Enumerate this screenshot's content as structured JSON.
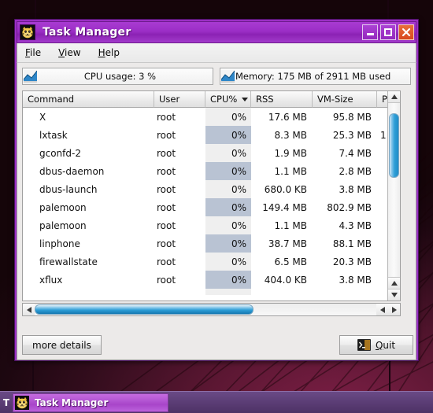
{
  "window": {
    "title": "Task Manager",
    "icon": "cat-icon",
    "controls": {
      "minimize": "minimize-button",
      "maximize": "maximize-button",
      "close": "close-button"
    }
  },
  "menubar": {
    "items": [
      {
        "label": "File",
        "mnemonic": "F"
      },
      {
        "label": "View",
        "mnemonic": "V"
      },
      {
        "label": "Help",
        "mnemonic": "H"
      }
    ]
  },
  "gauges": {
    "cpu": {
      "label": "CPU usage: 3 %",
      "icon": "cpu-chart-icon",
      "percent": 3
    },
    "memory": {
      "label": "Memory: 175 MB of 2911 MB used",
      "icon": "memory-chart-icon",
      "used_mb": 175,
      "total_mb": 2911
    }
  },
  "table": {
    "columns": [
      {
        "key": "command",
        "label": "Command",
        "sorted": false
      },
      {
        "key": "user",
        "label": "User",
        "sorted": false
      },
      {
        "key": "cpu",
        "label": "CPU%",
        "sorted": true,
        "sort_direction": "descending"
      },
      {
        "key": "rss",
        "label": "RSS",
        "sorted": false
      },
      {
        "key": "vm",
        "label": "VM-Size",
        "sorted": false
      },
      {
        "key": "p",
        "label": "P",
        "sorted": false
      }
    ],
    "rows": [
      {
        "command": "X",
        "user": "root",
        "cpu": "0%",
        "rss": "17.6 MB",
        "vm": "95.8 MB",
        "p": ""
      },
      {
        "command": "lxtask",
        "user": "root",
        "cpu": "0%",
        "rss": "8.3 MB",
        "vm": "25.3 MB",
        "p": "1"
      },
      {
        "command": "gconfd-2",
        "user": "root",
        "cpu": "0%",
        "rss": "1.9 MB",
        "vm": "7.4 MB",
        "p": ""
      },
      {
        "command": "dbus-daemon",
        "user": "root",
        "cpu": "0%",
        "rss": "1.1 MB",
        "vm": "2.8 MB",
        "p": ""
      },
      {
        "command": "dbus-launch",
        "user": "root",
        "cpu": "0%",
        "rss": "680.0 KB",
        "vm": "3.8 MB",
        "p": ""
      },
      {
        "command": "palemoon",
        "user": "root",
        "cpu": "0%",
        "rss": "149.4 MB",
        "vm": "802.9 MB",
        "p": ""
      },
      {
        "command": "palemoon",
        "user": "root",
        "cpu": "0%",
        "rss": "1.1 MB",
        "vm": "4.3 MB",
        "p": ""
      },
      {
        "command": "linphone",
        "user": "root",
        "cpu": "0%",
        "rss": "38.7 MB",
        "vm": "88.1 MB",
        "p": ""
      },
      {
        "command": "firewallstate",
        "user": "root",
        "cpu": "0%",
        "rss": "6.5 MB",
        "vm": "20.3 MB",
        "p": ""
      },
      {
        "command": "xflux",
        "user": "root",
        "cpu": "0%",
        "rss": "404.0 KB",
        "vm": "3.8 MB",
        "p": ""
      }
    ]
  },
  "scrollbars": {
    "vertical": {
      "thumb_top_pct": 6,
      "thumb_height_pct": 24
    },
    "horizontal": {
      "thumb_left_pct": 0,
      "thumb_width_pct": 64
    }
  },
  "buttons": {
    "more_details": "more details",
    "quit": "Quit",
    "quit_mnemonic": "Q",
    "quit_icon": "terminal-icon"
  },
  "taskbar": {
    "left_letter": "T",
    "task": {
      "label": "Task Manager",
      "icon": "cat-icon"
    }
  },
  "colors": {
    "titlebar": "#9b2ec6",
    "close_button": "#d8481f",
    "scroll_thumb": "#2f9fd8",
    "cpu_column_alt": "#b9c3d3",
    "taskbar": "#5b3d75",
    "desktop": "#5c1733"
  }
}
